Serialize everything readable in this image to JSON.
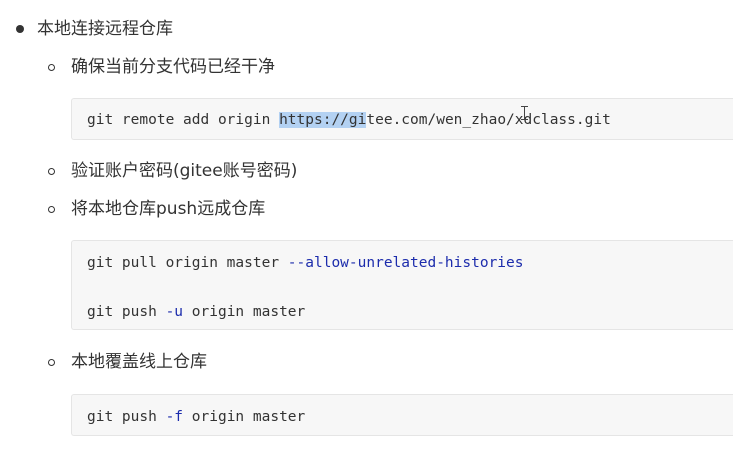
{
  "list": {
    "top_item": "本地连接远程仓库",
    "sub_items": [
      "确保当前分支代码已经干净",
      "验证账户密码(gitee账号密码)",
      "将本地仓库push远成仓库",
      "本地覆盖线上仓库"
    ]
  },
  "code": {
    "block1": {
      "pre": "git remote add origin ",
      "selected": "https://gi",
      "post": "tee.com/wen_zhao/xdclass.git"
    },
    "block2": {
      "line1_cmd": "git pull origin master ",
      "line1_flag": "--allow-unrelated-histories",
      "line2_pre": "git push ",
      "line2_flag": "-u",
      "line2_post": " origin master"
    },
    "block3": {
      "pre": "git push ",
      "flag": "-f",
      "post": " origin master"
    }
  },
  "colors": {
    "flag": "#1c2cac",
    "selection": "#b3d1f2",
    "code_bg": "#f7f7f7"
  },
  "icons": {
    "cursor": "text-cursor-icon"
  }
}
